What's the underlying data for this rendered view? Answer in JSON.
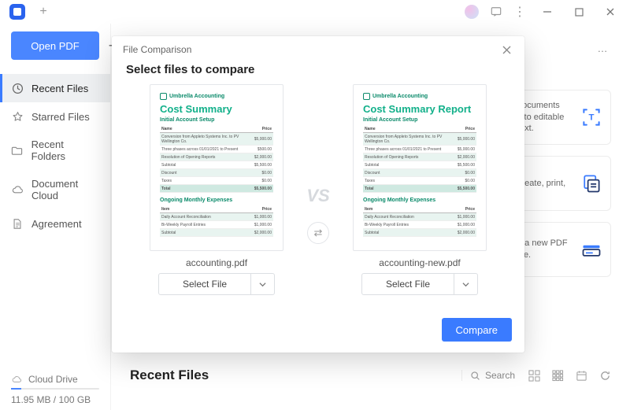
{
  "titlebar": {
    "plus": "+"
  },
  "sidebar": {
    "open_label": "Open PDF",
    "items": [
      {
        "label": "Recent Files",
        "icon": "clock-icon",
        "active": true
      },
      {
        "label": "Starred Files",
        "icon": "star-icon",
        "active": false
      },
      {
        "label": "Recent Folders",
        "icon": "folder-icon",
        "active": false
      },
      {
        "label": "Document Cloud",
        "icon": "cloud-icon",
        "active": false
      },
      {
        "label": "Agreement",
        "icon": "document-icon",
        "active": false
      }
    ],
    "cloud": {
      "label": "Cloud Drive",
      "usage": "11.95 MB / 100 GB"
    }
  },
  "main": {
    "cards": [
      {
        "text": "documents into editable text.",
        "icon": "ocr"
      },
      {
        "text": "create, print,",
        "icon": "copy"
      },
      {
        "text": "e a new PDF file.",
        "icon": "scanner"
      }
    ],
    "recent_title": "Recent Files",
    "search_placeholder": "Search",
    "ellipsis": "…"
  },
  "modal": {
    "header": "File Comparison",
    "title": "Select files to compare",
    "vs": "VS",
    "swap_glyph": "⇄",
    "files": [
      {
        "name": "accounting.pdf",
        "thumb": {
          "brand": "Umbrella Accounting",
          "title": "Cost Summary",
          "section1": "Initial Account Setup",
          "section2": "Ongoing Monthly Expenses"
        }
      },
      {
        "name": "accounting-new.pdf",
        "thumb": {
          "brand": "Umbrella Accounting",
          "title": "Cost Summary Report",
          "section1": "Initial Account Setup",
          "section2": "Ongoing Monthly Expenses"
        }
      }
    ],
    "select_label": "Select File",
    "compare_label": "Compare"
  }
}
